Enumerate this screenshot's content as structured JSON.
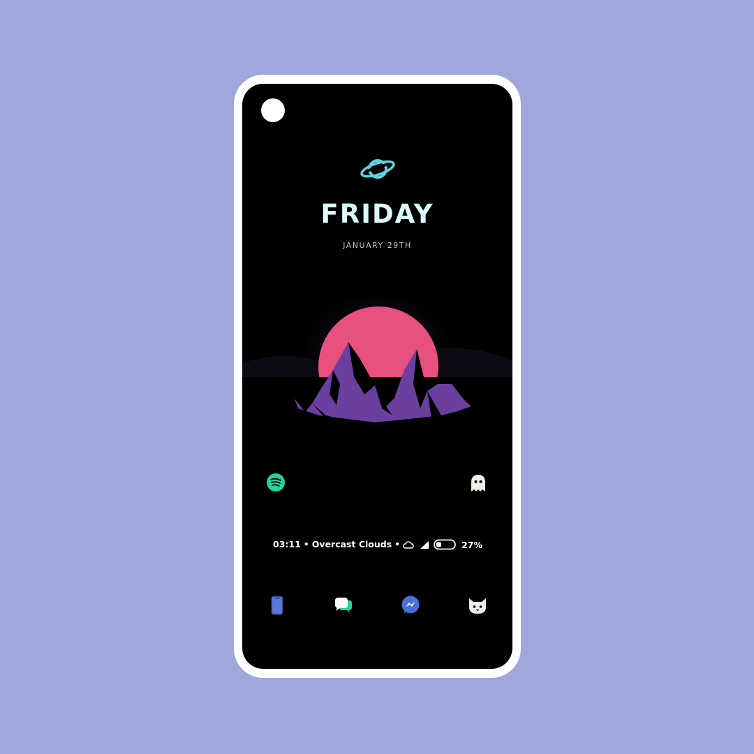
{
  "lockscreen": {
    "day": "FRIDAY",
    "date": "JANUARY 29TH"
  },
  "status_bar": {
    "time": "03:11",
    "separator": "•",
    "weather": "Overcast Clouds",
    "battery": "27%"
  },
  "icons": {
    "top": "planet-icon",
    "shortcut_left": "spotify-icon",
    "shortcut_right": "ghost-icon",
    "dock": [
      "phone-icon",
      "chat-icon",
      "messenger-icon",
      "cat-icon"
    ]
  },
  "colors": {
    "background": "#9fa8db",
    "screen": "#000000",
    "accent_cyan": "#5fd3e6",
    "sun": "#e8507e",
    "mountain": "#6b3fa0",
    "spotify": "#1ed69a"
  }
}
